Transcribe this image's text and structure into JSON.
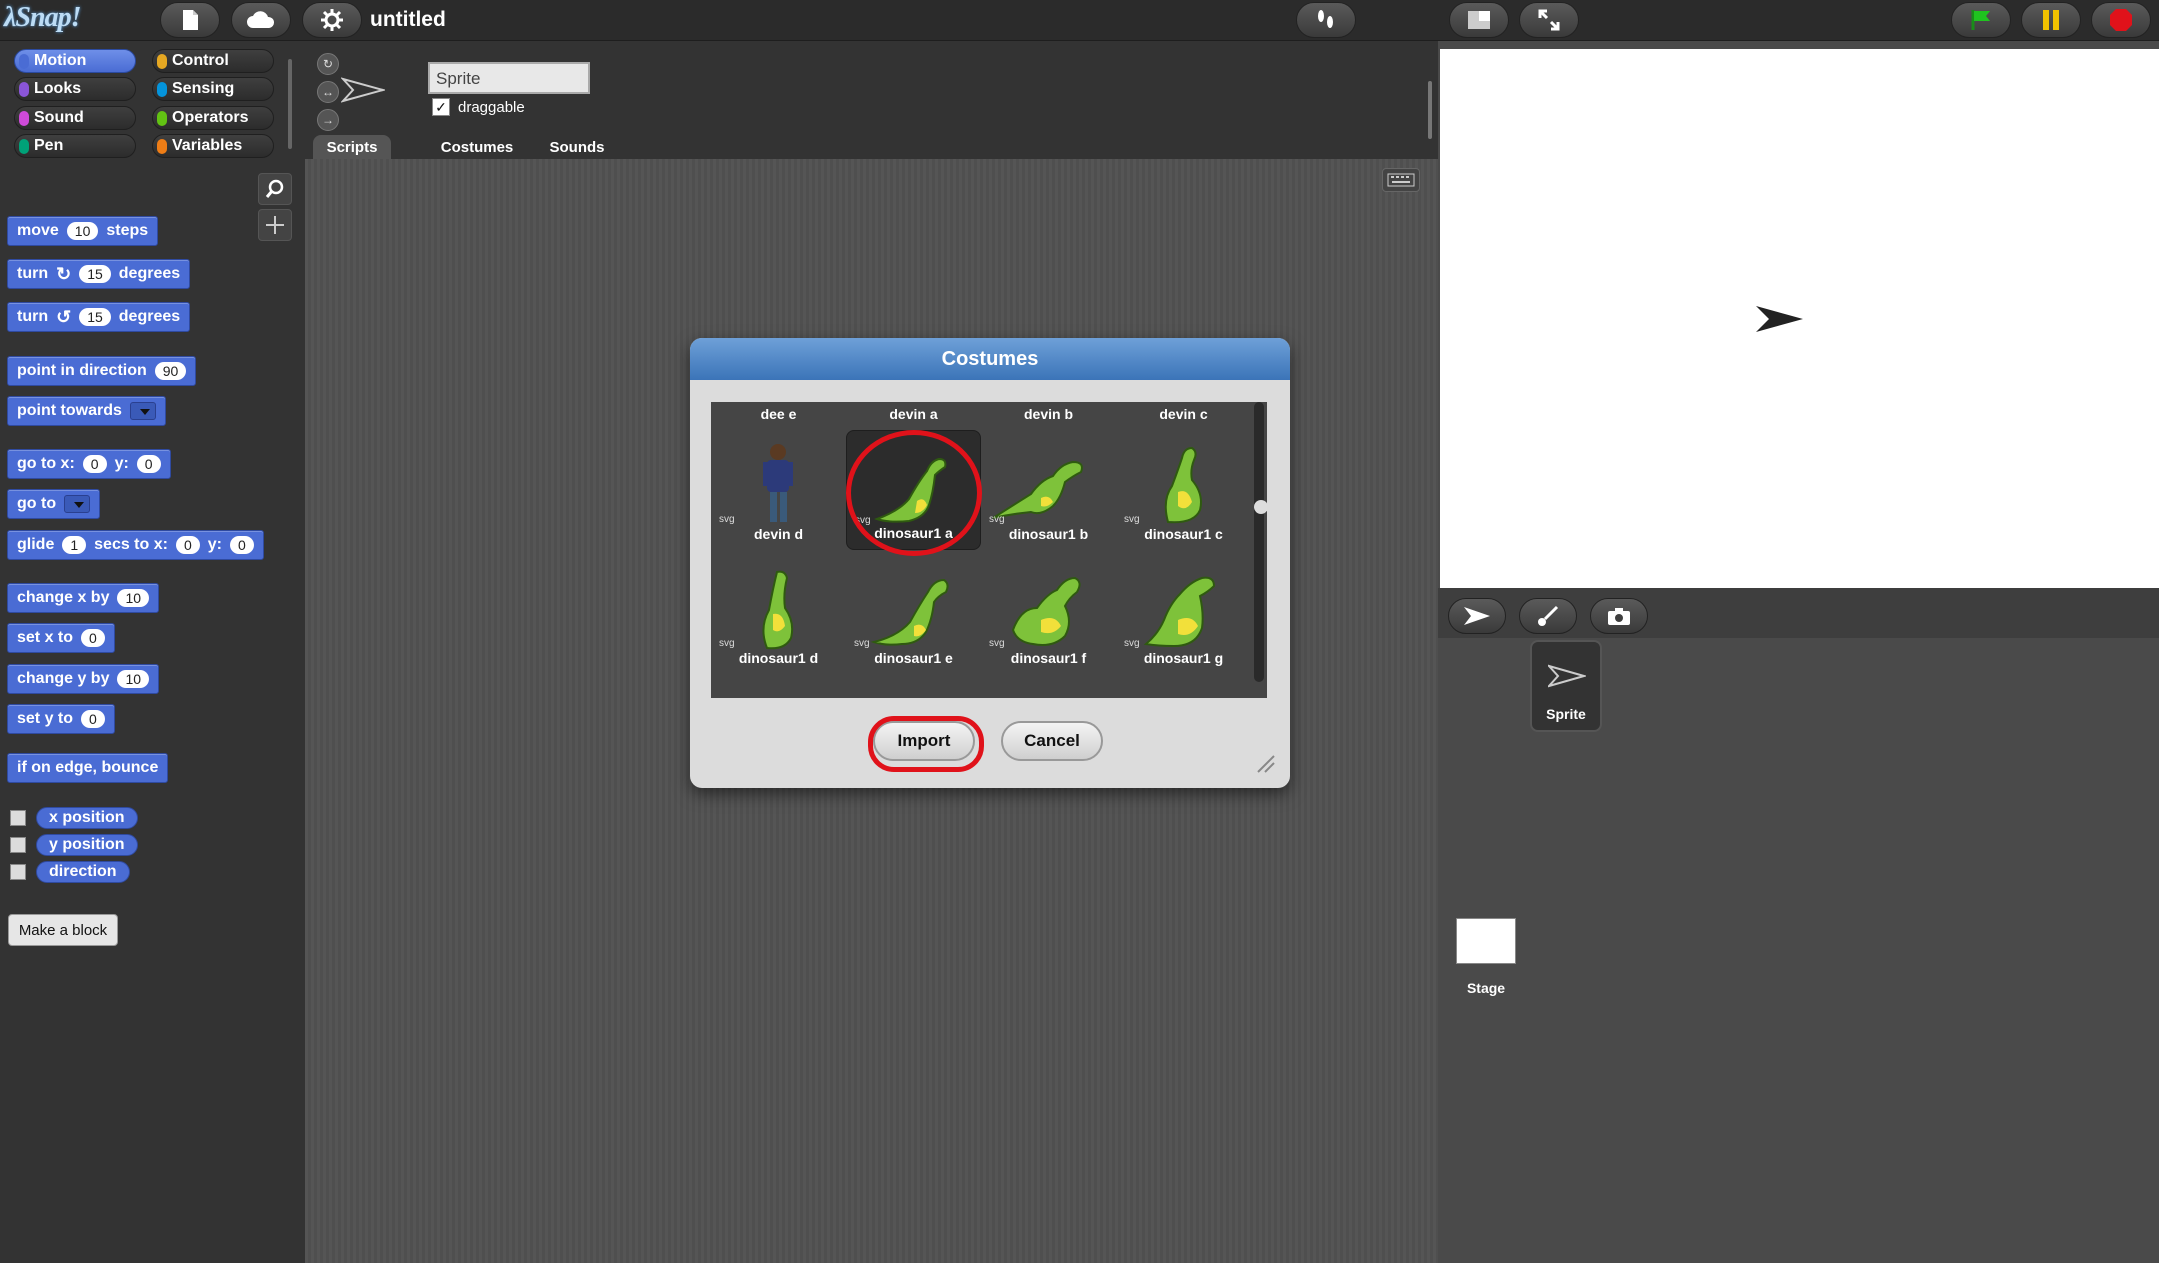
{
  "app": {
    "logo_text": "λSnap!",
    "project_title": "untitled"
  },
  "categories": [
    {
      "label": "Motion",
      "color": "#4a6cd4",
      "selected": true
    },
    {
      "label": "Control",
      "color": "#e6a822",
      "selected": false
    },
    {
      "label": "Looks",
      "color": "#8a55d7",
      "selected": false
    },
    {
      "label": "Sensing",
      "color": "#0494dc",
      "selected": false
    },
    {
      "label": "Sound",
      "color": "#cf4ad9",
      "selected": false
    },
    {
      "label": "Operators",
      "color": "#62c213",
      "selected": false
    },
    {
      "label": "Pen",
      "color": "#00a178",
      "selected": false
    },
    {
      "label": "Variables",
      "color": "#ee7d16",
      "selected": false
    }
  ],
  "blocks": {
    "move": {
      "t1": "move",
      "v": "10",
      "t2": "steps"
    },
    "turn_cw": {
      "t1": "turn",
      "v": "15",
      "t2": "degrees"
    },
    "turn_ccw": {
      "t1": "turn",
      "v": "15",
      "t2": "degrees"
    },
    "point_dir": {
      "t1": "point in direction",
      "v": "90"
    },
    "point_towards": {
      "t1": "point towards"
    },
    "goto_xy": {
      "t1": "go to x:",
      "vx": "0",
      "t2": "y:",
      "vy": "0"
    },
    "goto": {
      "t1": "go to"
    },
    "glide": {
      "t1": "glide",
      "v": "1",
      "t2": "secs to x:",
      "vx": "0",
      "t3": "y:",
      "vy": "0"
    },
    "change_x": {
      "t1": "change x by",
      "v": "10"
    },
    "set_x": {
      "t1": "set x to",
      "v": "0"
    },
    "change_y": {
      "t1": "change y by",
      "v": "10"
    },
    "set_y": {
      "t1": "set y to",
      "v": "0"
    },
    "bounce": {
      "t1": "if on edge, bounce"
    },
    "x_position": "x position",
    "y_position": "y position",
    "direction": "direction"
  },
  "make_block": "Make a block",
  "sprite": {
    "name": "Sprite",
    "draggable_label": "draggable",
    "draggable_checked": "✓"
  },
  "tabs": [
    "Scripts",
    "Costumes",
    "Sounds"
  ],
  "corral": {
    "sprite_label": "Sprite",
    "stage_label": "Stage"
  },
  "dialog": {
    "title": "Costumes",
    "top_labels": [
      "dee e",
      "devin a",
      "devin b",
      "devin c"
    ],
    "costumes": [
      {
        "name": "devin d",
        "tag": "svg"
      },
      {
        "name": "dinosaur1 a",
        "tag": "svg"
      },
      {
        "name": "dinosaur1 b",
        "tag": "svg"
      },
      {
        "name": "dinosaur1 c",
        "tag": "svg"
      },
      {
        "name": "dinosaur1 d",
        "tag": "svg"
      },
      {
        "name": "dinosaur1 e",
        "tag": "svg"
      },
      {
        "name": "dinosaur1 f",
        "tag": "svg"
      },
      {
        "name": "dinosaur1 g",
        "tag": "svg"
      }
    ],
    "import_label": "Import",
    "cancel_label": "Cancel"
  },
  "colors": {
    "motion": "#4a6cd4",
    "highlight_ring": "#e0121a",
    "dino_green": "#7ec23a"
  }
}
